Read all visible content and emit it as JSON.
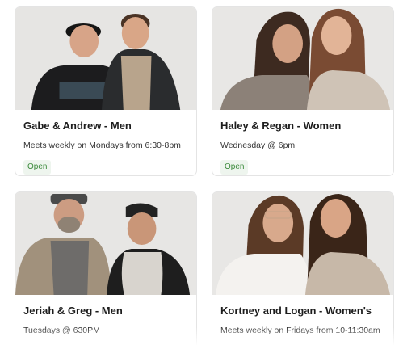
{
  "groups": [
    {
      "title": "Gabe & Andrew - Men",
      "description": "Meets weekly on Mondays from 6:30-8pm",
      "status": "Open"
    },
    {
      "title": "Haley & Regan - Women",
      "description": "Wednesday @ 6pm",
      "status": "Open"
    },
    {
      "title": "Jeriah & Greg - Men",
      "description": "Tuesdays @ 630PM"
    },
    {
      "title": "Kortney and Logan - Women's",
      "description": "Meets weekly on Fridays from 10-11:30am"
    }
  ],
  "colors": {
    "status_open_text": "#3b8a3b",
    "status_open_bg": "#eef5ee",
    "card_border": "#e4e4e4"
  }
}
